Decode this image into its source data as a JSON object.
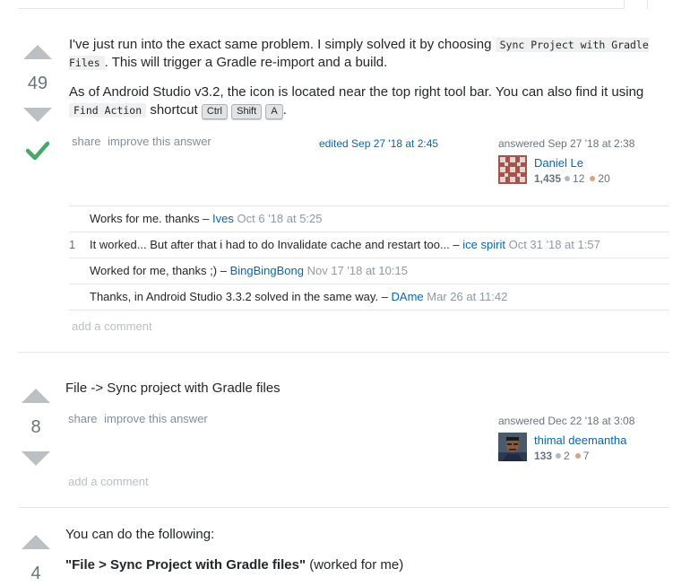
{
  "answers": [
    {
      "score": "49",
      "accepted": true,
      "paragraph1": {
        "text_before": "I've just run into the exact same problem. I simply solved it by choosing",
        "code": "Sync Project with Gradle Files",
        "text_after": ". This will trigger a Gradle re-import and a build."
      },
      "paragraph2": {
        "text_before": "As of Android Studio v3.2, the icon is located near the top right tool bar. You can also find it using",
        "code": "Find Action",
        "text_mid": "shortcut",
        "keys": [
          "Ctrl",
          "Shift",
          "A"
        ],
        "text_end": "."
      },
      "menu": {
        "share": "share",
        "improve": "improve this answer"
      },
      "edited": "edited Sep 27 '18 at 2:45",
      "answered": "answered Sep 27 '18 at 2:38",
      "user": {
        "name": "Daniel Le",
        "rep": "1,435",
        "silver": "12",
        "bronze": "20"
      },
      "comments": [
        {
          "score": "",
          "text": "Works for me. thanks –",
          "user": "Ives",
          "date": "Oct 6 '18 at 5:25"
        },
        {
          "score": "1",
          "text": "It worked... But after that i had to do Invalidate cache and restart too... –",
          "user": "ice spirit",
          "date": "Oct 31 '18 at 1:57"
        },
        {
          "score": "",
          "text": "Worked for me, thanks ;) –",
          "user": "BingBingBong",
          "date": "Nov 17 '18 at 10:15"
        },
        {
          "score": "",
          "text": "Thanks, in Android Studio 3.3.2 solved in the same way. –",
          "user": "DAme",
          "date": "Mar 26 at 11:42"
        }
      ],
      "add_comment": "add a comment"
    },
    {
      "score": "8",
      "text": "File -> Sync project with Gradle files",
      "menu": {
        "share": "share",
        "improve": "improve this answer"
      },
      "answered": "answered Dec 22 '18 at 3:08",
      "user": {
        "name": "thimal deemantha",
        "rep": "133",
        "silver": "2",
        "bronze": "7"
      },
      "add_comment": "add a comment"
    },
    {
      "score": "4",
      "text": "You can do the following:",
      "bold": "\"File > Sync Project with Gradle files\"",
      "after_bold": "(worked for me)"
    }
  ],
  "colors": {
    "link": "#0c65a5",
    "accepted": "#48a868",
    "vote_arrow": "#bbc0c4",
    "silver_badge": "#b4b8bc",
    "bronze_badge": "#d1a684"
  }
}
